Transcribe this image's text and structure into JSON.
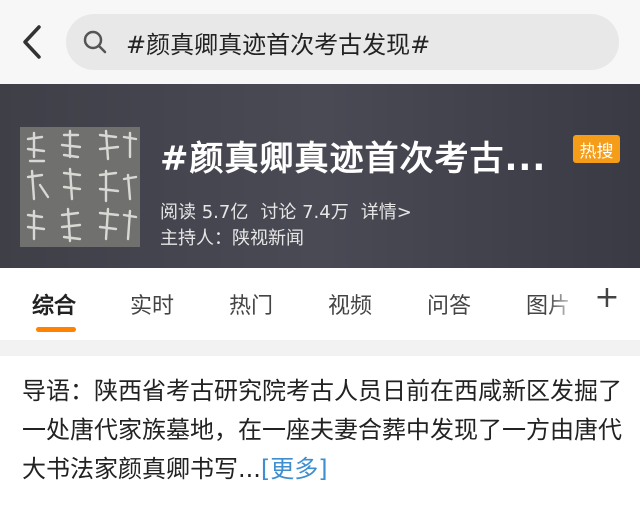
{
  "search": {
    "query": "#颜真卿真迹首次考古发现#"
  },
  "topic": {
    "title": "#颜真卿真迹首次考古...",
    "badge": "热搜",
    "read_label": "阅读",
    "read_count": "5.7亿",
    "discuss_label": "讨论",
    "discuss_count": "7.4万",
    "details": "详情>",
    "host_label": "主持人：",
    "host_name": "陕视新闻"
  },
  "tabs": [
    {
      "label": "综合",
      "active": true
    },
    {
      "label": "实时"
    },
    {
      "label": "热门"
    },
    {
      "label": "视频"
    },
    {
      "label": "问答"
    },
    {
      "label": "图片"
    }
  ],
  "tab_add_icon": "plus-icon",
  "intro": {
    "text": "导语：陕西省考古研究院考古人员日前在西咸新区发掘了一处唐代家族墓地，在一座夫妻合葬中发现了一方由唐代大书法家颜真卿书写...",
    "more": "[更多]"
  },
  "colors": {
    "accent": "#ff8200",
    "badge": "#f59c19",
    "link": "#3e8ed0",
    "banner": "#44444e"
  }
}
